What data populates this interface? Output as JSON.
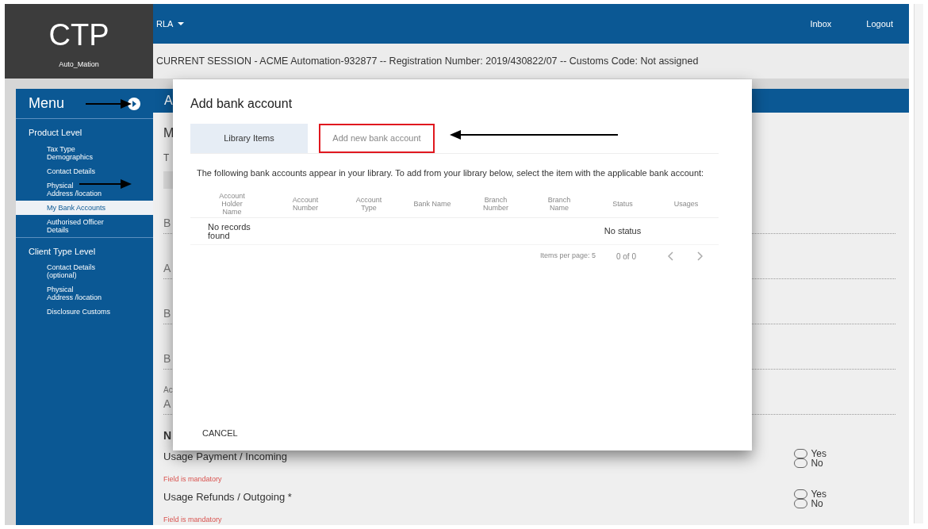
{
  "header": {
    "logo": "CTP",
    "user": "Auto_Mation",
    "menu": "RLA",
    "links": [
      "Inbox",
      "Logout"
    ],
    "session": "CURRENT SESSION - ACME Automation-932877 -- Registration Number: 2019/430822/07 -- Customs Code: Not assigned"
  },
  "sidebar": {
    "title": "Menu",
    "sections": [
      {
        "label": "Product Level",
        "items": [
          {
            "label": "Tax Type\nDemographics",
            "selected": false
          },
          {
            "label": "Contact Details",
            "selected": false
          },
          {
            "label": "Physical\nAddress /location",
            "selected": false
          },
          {
            "label": "My Bank Accounts",
            "selected": true
          },
          {
            "label": "Authorised Officer\nDetails",
            "selected": false
          }
        ]
      },
      {
        "label": "Client Type Level",
        "items": [
          {
            "label": "Contact Details\n(optional)",
            "selected": false
          },
          {
            "label": "Physical\nAddress /location",
            "selected": false
          },
          {
            "label": "Disclosure Customs",
            "selected": false
          }
        ]
      }
    ]
  },
  "main": {
    "header": "A",
    "title": "M",
    "subtitle": "T",
    "fields": [
      {
        "kind": "line",
        "label": "B"
      },
      {
        "kind": "line",
        "label": "A"
      },
      {
        "kind": "line",
        "label": "B"
      },
      {
        "kind": "line",
        "label": "B"
      },
      {
        "kind": "stacked",
        "hint": "Ac",
        "label": "A"
      }
    ],
    "section": "N",
    "questions": [
      {
        "label": "Usage  Payment / Incoming",
        "error": "Field is mandatory",
        "options": [
          {
            "label": "Yes",
            "selected": false
          },
          {
            "label": "No",
            "selected": false
          }
        ]
      },
      {
        "label": "Usage  Refunds / Outgoing *",
        "error": "Field is mandatory",
        "options": [
          {
            "label": "Yes",
            "selected": false
          },
          {
            "label": "No",
            "selected": false
          }
        ]
      }
    ]
  },
  "dialog": {
    "title": "Add bank account",
    "tabs": [
      {
        "label": "Library Items",
        "selected": true,
        "highlighted": false
      },
      {
        "label": "Add new bank account",
        "selected": false,
        "highlighted": true
      }
    ],
    "intro": "The following bank accounts appear in your library. To add from your library below, select the item with the applicable bank account:",
    "table": {
      "columns": [
        "Account Holder Name",
        "Account Number",
        "Account Type",
        "Bank Name",
        "Branch Number",
        "Branch Name",
        "Status",
        "Usages"
      ],
      "rows": [
        [
          "No records found",
          "",
          "",
          "",
          "",
          "",
          "No status",
          ""
        ]
      ]
    },
    "pagination": {
      "page_size": "Items per page: 5",
      "range": "0 of 0"
    },
    "cancel": "CANCEL"
  }
}
